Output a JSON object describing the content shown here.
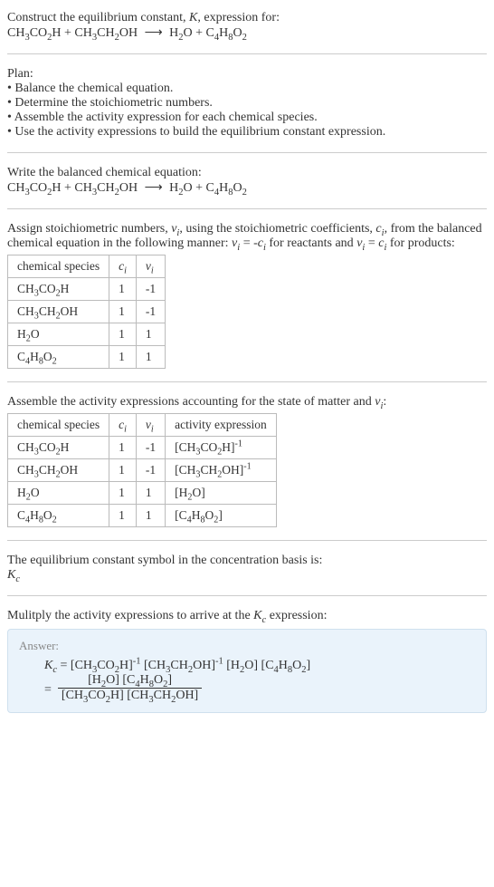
{
  "intro": {
    "line1": "Construct the equilibrium constant, K, expression for:",
    "equation": "CH₃CO₂H + CH₃CH₂OH ⟶ H₂O + C₄H₈O₂"
  },
  "plan": {
    "heading": "Plan:",
    "items": [
      "Balance the chemical equation.",
      "Determine the stoichiometric numbers.",
      "Assemble the activity expression for each chemical species.",
      "Use the activity expressions to build the equilibrium constant expression."
    ]
  },
  "balanced": {
    "heading": "Write the balanced chemical equation:",
    "equation": "CH₃CO₂H + CH₃CH₂OH ⟶ H₂O + C₄H₈O₂"
  },
  "stoich_intro": {
    "text1": "Assign stoichiometric numbers, νᵢ, using the stoichiometric coefficients, cᵢ, from the balanced chemical equation in the following manner: νᵢ = -cᵢ for reactants and νᵢ = cᵢ for products:"
  },
  "table1": {
    "headers": [
      "chemical species",
      "cᵢ",
      "νᵢ"
    ],
    "rows": [
      [
        "CH₃CO₂H",
        "1",
        "-1"
      ],
      [
        "CH₃CH₂OH",
        "1",
        "-1"
      ],
      [
        "H₂O",
        "1",
        "1"
      ],
      [
        "C₄H₈O₂",
        "1",
        "1"
      ]
    ]
  },
  "activity_intro": "Assemble the activity expressions accounting for the state of matter and νᵢ:",
  "table2": {
    "headers": [
      "chemical species",
      "cᵢ",
      "νᵢ",
      "activity expression"
    ],
    "rows": [
      [
        "CH₃CO₂H",
        "1",
        "-1",
        "[CH₃CO₂H]⁻¹"
      ],
      [
        "CH₃CH₂OH",
        "1",
        "-1",
        "[CH₃CH₂OH]⁻¹"
      ],
      [
        "H₂O",
        "1",
        "1",
        "[H₂O]"
      ],
      [
        "C₄H₈O₂",
        "1",
        "1",
        "[C₄H₈O₂]"
      ]
    ]
  },
  "symbol_intro": "The equilibrium constant symbol in the concentration basis is:",
  "symbol": "K_c",
  "multiply_intro": "Mulitply the activity expressions to arrive at the K_c expression:",
  "answer": {
    "label": "Answer:",
    "line1": "K_c = [CH₃CO₂H]⁻¹ [CH₃CH₂OH]⁻¹ [H₂O] [C₄H₈O₂]",
    "frac_num": "[H₂O] [C₄H₈O₂]",
    "frac_den": "[CH₃CO₂H] [CH₃CH₂OH]"
  }
}
